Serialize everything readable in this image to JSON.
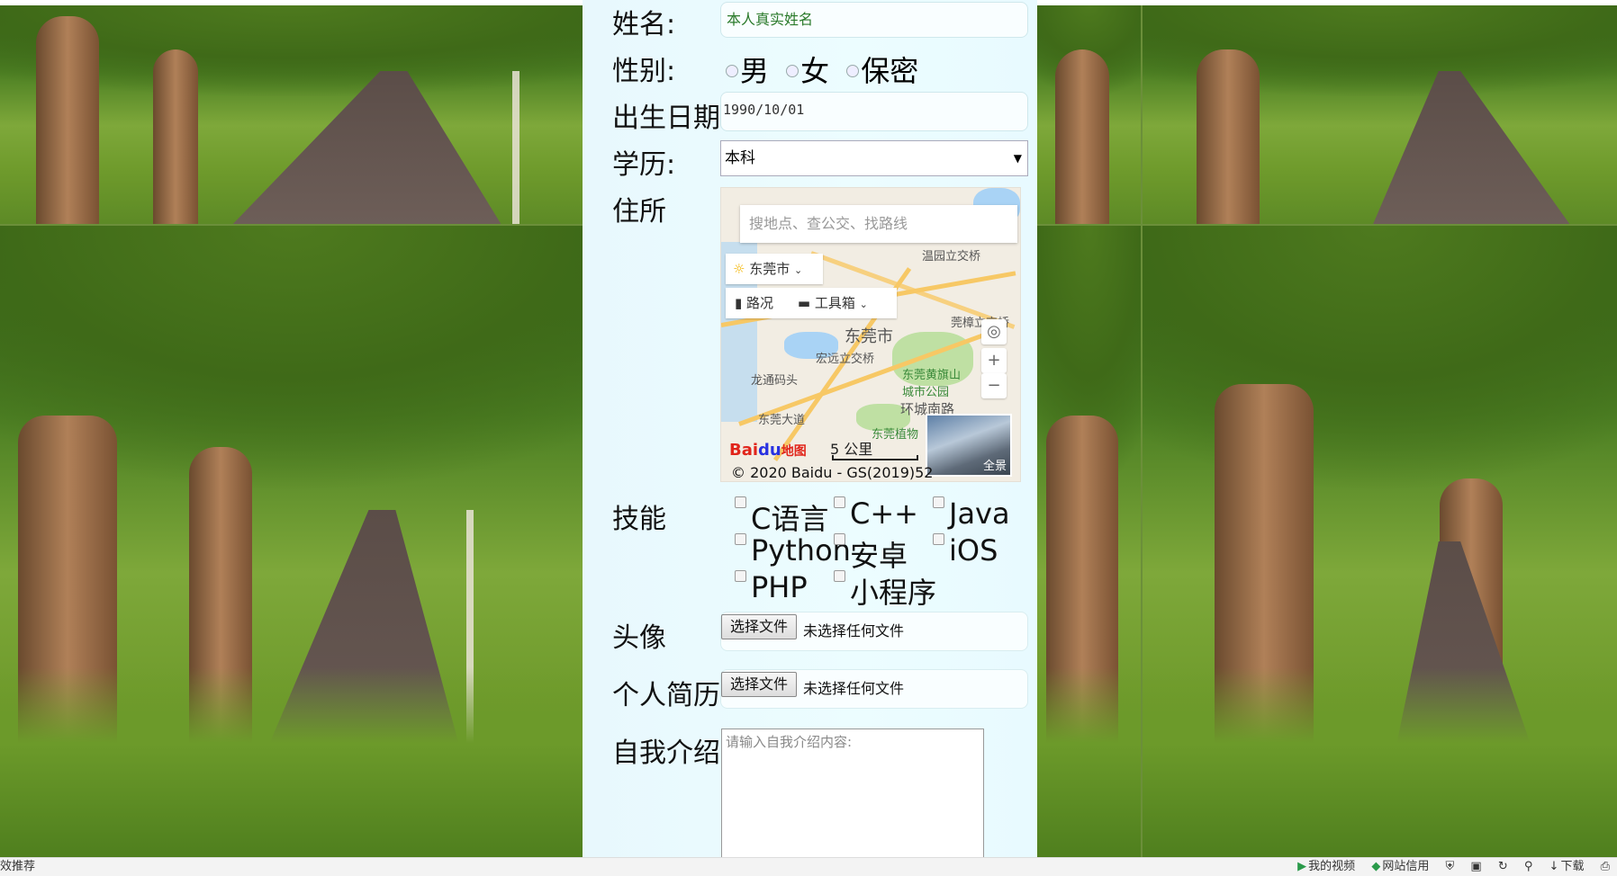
{
  "form": {
    "name": {
      "label": "姓名:",
      "value": "本人真实姓名"
    },
    "gender": {
      "label": "性别:",
      "options": [
        "男",
        "女",
        "保密"
      ]
    },
    "birth": {
      "label": "出生日期",
      "value": "1990/10/01"
    },
    "education": {
      "label": "学历:",
      "selected": "本科"
    },
    "address": {
      "label": "住所",
      "map": {
        "search_placeholder": "搜地点、查公交、找路线",
        "city": "东莞市",
        "traffic": "路况",
        "toolbox": "工具箱",
        "labels": {
          "overpass1": "温园立交桥",
          "city_center": "东莞市",
          "overpass2": "莞樟立交桥",
          "overpass3": "宏远立交桥",
          "park": "东莞黄旗山城市公园",
          "longtong": "龙通码头",
          "huancheng": "环城南路",
          "avenue": "东莞大道",
          "botanic": "东莞植物"
        },
        "logo_main": "Bai",
        "logo_du": "du",
        "logo_suffix": "地图",
        "scale": "5 公里",
        "copyright": "© 2020 Baidu - GS(2019)52",
        "panorama": "全景"
      }
    },
    "skills": {
      "label": "技能",
      "items": [
        "C语言",
        "C++",
        "Java",
        "Python",
        "安卓",
        "iOS",
        "PHP",
        "小程序"
      ]
    },
    "avatar": {
      "label": "头像",
      "button": "选择文件",
      "status": "未选择任何文件"
    },
    "resume": {
      "label": "个人简历:",
      "button": "选择文件",
      "status": "未选择任何文件"
    },
    "intro": {
      "label": "自我介绍",
      "placeholder": "请输入自我介绍内容:"
    }
  },
  "statusbar": {
    "left": "效推荐",
    "items": [
      "我的视频",
      "网站信用",
      "下载"
    ]
  }
}
